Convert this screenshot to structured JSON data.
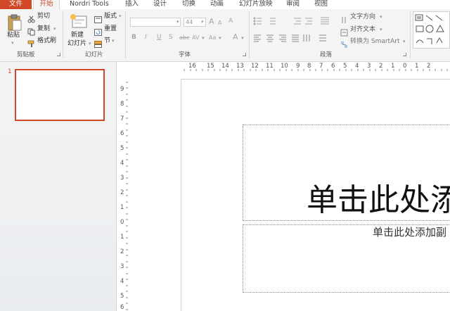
{
  "tabs": {
    "file": "文件",
    "home": "开始",
    "nordri": "Nordri Tools",
    "insert": "插入",
    "design": "设计",
    "transitions": "切换",
    "animations": "动画",
    "slideshow": "幻灯片放映",
    "review": "审阅",
    "view": "视图"
  },
  "clipboard": {
    "paste": "粘贴",
    "cut": "剪切",
    "copy": "复制",
    "format_painter": "格式刷",
    "group_label": "剪贴板"
  },
  "slides_group": {
    "new_slide_line1": "新建",
    "new_slide_line2": "幻灯片",
    "layout": "版式",
    "reset": "重置",
    "section": "节",
    "group_label": "幻灯片"
  },
  "font": {
    "font_name": "",
    "font_size": "44",
    "bold": "B",
    "italic": "I",
    "underline": "U",
    "shadow": "S",
    "strikethrough": "abc",
    "spacing": "AV",
    "change_case": "Aa",
    "font_color": "A",
    "grow": "A",
    "shrink": "A",
    "clear": "A",
    "group_label": "字体"
  },
  "paragraph": {
    "text_direction": "文字方向",
    "align_text": "对齐文本",
    "convert_smartart": "转换为 SmartArt",
    "group_label": "段落"
  },
  "rulers": {
    "horizontal": [
      "16",
      "15",
      "14",
      "13",
      "12",
      "11",
      "10",
      "9",
      "8",
      "7",
      "6",
      "5",
      "4",
      "3",
      "2",
      "1",
      "0",
      "1",
      "2"
    ],
    "vertical": [
      "9",
      "8",
      "7",
      "6",
      "5",
      "4",
      "3",
      "2",
      "1",
      "0",
      "1",
      "2",
      "3",
      "4",
      "5",
      "6"
    ]
  },
  "thumbnails": {
    "slide_number": "1"
  },
  "slide": {
    "title_placeholder": "单击此处添",
    "subtitle_placeholder": "单击此处添加副"
  },
  "colors": {
    "accent": "#d24726",
    "ribbon_bg": "#f4f4f4",
    "pane_bg": "#f3f3f3"
  }
}
